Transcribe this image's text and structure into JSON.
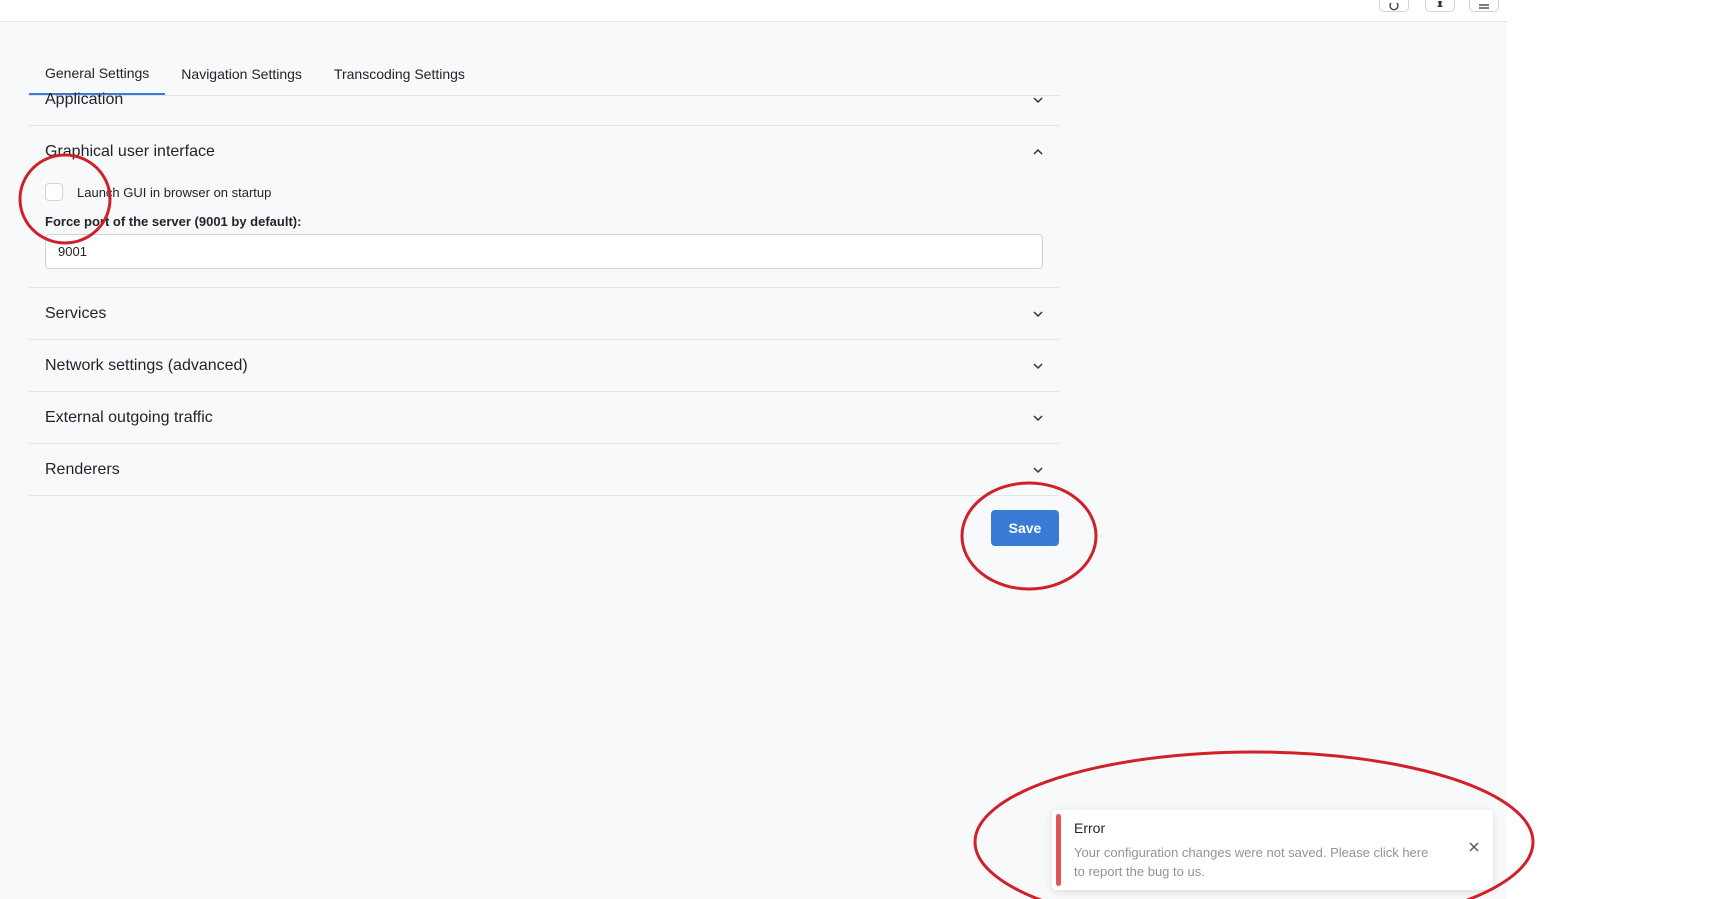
{
  "tabs": [
    {
      "label": "General Settings",
      "active": true
    },
    {
      "label": "Navigation Settings",
      "active": false
    },
    {
      "label": "Transcoding Settings",
      "active": false
    }
  ],
  "sections": {
    "application": {
      "title": "Application",
      "expanded": false
    },
    "gui": {
      "title": "Graphical user interface",
      "expanded": true,
      "launch_checkbox_label": "Launch GUI in browser on startup",
      "launch_checked": false,
      "port_label": "Force port of the server (9001 by default):",
      "port_value": "9001"
    },
    "services": {
      "title": "Services",
      "expanded": false
    },
    "network": {
      "title": "Network settings (advanced)",
      "expanded": false
    },
    "external": {
      "title": "External outgoing traffic",
      "expanded": false
    },
    "renderers": {
      "title": "Renderers",
      "expanded": false
    }
  },
  "save_label": "Save",
  "toast": {
    "title": "Error",
    "message": "Your configuration changes were not saved. Please click here to report the bug to us."
  },
  "colors": {
    "accent": "#3a7bd5",
    "error": "#e05656",
    "annotation": "#d0202a",
    "background": "#f8f9fa"
  },
  "icons": {
    "top_toolbar": [
      "power-icon",
      "pin-icon",
      "menu-icon"
    ],
    "section_toggle": "chevron-icon",
    "toast_close": "close-icon"
  }
}
